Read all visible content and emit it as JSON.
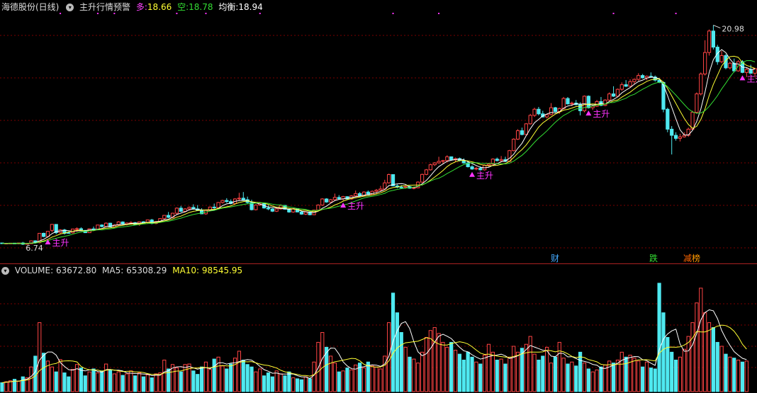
{
  "price_panel": {
    "stock_name": "海德股份(日线)",
    "indicator_name": "主升行情预警",
    "long_label": "多:",
    "long_value": "18.66",
    "short_label": "空:",
    "short_value": "18.78",
    "balance_label": "均衡:",
    "balance_value": "18.94",
    "high_marker": "20.98",
    "low_marker": "6.74",
    "signal_label": "主升"
  },
  "volume_panel": {
    "volume_label": "VOLUME:",
    "volume_value": "63672.80",
    "ma5_label": "MA5:",
    "ma5_value": "65308.29",
    "ma10_label": "MA10:",
    "ma10_value": "98545.95"
  },
  "event_tags": [
    {
      "text": "财",
      "color": "#44aaff"
    },
    {
      "text": "跌",
      "color": "#33dd33"
    },
    {
      "text": "减",
      "color": "#ff6600"
    },
    {
      "text": "榜",
      "color": "#ff9900"
    }
  ],
  "colors": {
    "up": "#ff4444",
    "down": "#4fe9f0",
    "ma_white": "#ffffff",
    "ma_yellow": "#ffff33",
    "ma_green": "#33dd33",
    "signal": "#ff33ff",
    "grid": "#7a0000"
  },
  "chart_data": {
    "type": "candlestick",
    "y_range": [
      6.0,
      21.7
    ],
    "volume_range": [
      0,
      230000
    ],
    "candles": [
      [
        6.78,
        6.78,
        6.74,
        6.74
      ],
      [
        6.75,
        6.78,
        6.73,
        6.76
      ],
      [
        6.76,
        6.77,
        6.76,
        6.77
      ],
      [
        6.77,
        6.77,
        6.72,
        6.73
      ],
      [
        6.73,
        6.8,
        6.7,
        6.78
      ],
      [
        6.78,
        6.85,
        6.65,
        6.7
      ],
      [
        6.7,
        6.76,
        6.7,
        6.74
      ],
      [
        6.73,
        6.95,
        6.72,
        6.92
      ],
      [
        6.92,
        6.95,
        6.74,
        6.8
      ],
      [
        6.8,
        7.42,
        6.75,
        7.41
      ],
      [
        7.41,
        7.45,
        7.15,
        7.2
      ],
      [
        7.2,
        7.55,
        7.15,
        7.54
      ],
      [
        7.6,
        8.02,
        7.48,
        7.99
      ],
      [
        7.99,
        7.82,
        7.35,
        7.45
      ],
      [
        7.45,
        7.68,
        7.4,
        7.63
      ],
      [
        7.63,
        7.7,
        7.33,
        7.4
      ],
      [
        7.45,
        7.52,
        7.38,
        7.44
      ],
      [
        7.44,
        7.7,
        7.4,
        7.69
      ],
      [
        7.69,
        7.8,
        7.5,
        7.71
      ],
      [
        7.71,
        7.8,
        7.56,
        7.6
      ],
      [
        7.6,
        7.62,
        7.43,
        7.45
      ],
      [
        7.45,
        7.73,
        7.44,
        7.7
      ],
      [
        7.7,
        7.85,
        7.6,
        7.65
      ],
      [
        7.65,
        7.96,
        7.6,
        7.95
      ],
      [
        7.95,
        8.0,
        7.8,
        7.85
      ],
      [
        7.85,
        8.12,
        7.8,
        8.07
      ],
      [
        8.07,
        8.1,
        7.8,
        7.83
      ],
      [
        7.83,
        8.0,
        7.78,
        7.95
      ],
      [
        7.95,
        8.2,
        7.9,
        8.15
      ],
      [
        8.15,
        8.19,
        7.95,
        8.0
      ],
      [
        8.0,
        8.12,
        7.92,
        8.08
      ],
      [
        8.08,
        8.2,
        8.0,
        8.1
      ],
      [
        8.1,
        8.15,
        7.96,
        7.98
      ],
      [
        7.98,
        8.18,
        7.9,
        8.16
      ],
      [
        8.16,
        8.2,
        8.05,
        8.12
      ],
      [
        8.12,
        8.3,
        8.05,
        8.28
      ],
      [
        8.28,
        8.35,
        8.0,
        8.05
      ],
      [
        8.05,
        8.2,
        8.0,
        8.18
      ],
      [
        8.18,
        8.4,
        8.1,
        8.37
      ],
      [
        8.37,
        8.6,
        8.3,
        8.58
      ],
      [
        8.58,
        8.8,
        8.4,
        8.45
      ],
      [
        8.45,
        8.75,
        8.4,
        8.72
      ],
      [
        8.72,
        9.1,
        8.65,
        9.05
      ],
      [
        9.05,
        9.2,
        8.8,
        8.84
      ],
      [
        8.84,
        9.05,
        8.78,
        9.0
      ],
      [
        9.0,
        9.16,
        8.9,
        9.1
      ],
      [
        9.1,
        9.3,
        8.95,
        9.0
      ],
      [
        9.0,
        9.25,
        8.88,
        8.91
      ],
      [
        8.91,
        9.05,
        8.65,
        8.68
      ],
      [
        8.68,
        8.95,
        8.62,
        8.9
      ],
      [
        8.9,
        9.15,
        8.85,
        9.12
      ],
      [
        9.12,
        9.35,
        9.0,
        9.07
      ],
      [
        9.07,
        9.45,
        9.05,
        9.42
      ],
      [
        9.42,
        9.6,
        9.35,
        9.55
      ],
      [
        9.55,
        9.7,
        9.4,
        9.48
      ],
      [
        9.48,
        9.62,
        9.3,
        9.35
      ],
      [
        9.35,
        9.7,
        9.3,
        9.65
      ],
      [
        9.65,
        10.05,
        9.55,
        9.7
      ],
      [
        9.7,
        10.1,
        9.55,
        9.6
      ],
      [
        9.6,
        9.8,
        9.35,
        9.42
      ],
      [
        9.42,
        9.6,
        8.9,
        8.95
      ],
      [
        8.95,
        9.3,
        8.9,
        9.25
      ],
      [
        9.25,
        9.45,
        9.2,
        9.38
      ],
      [
        9.38,
        9.4,
        9.02,
        9.06
      ],
      [
        9.06,
        9.25,
        8.92,
        9.0
      ],
      [
        9.0,
        9.05,
        8.8,
        8.85
      ],
      [
        8.85,
        9.1,
        8.8,
        9.0
      ],
      [
        9.0,
        9.3,
        8.95,
        9.23
      ],
      [
        9.23,
        9.25,
        8.95,
        8.98
      ],
      [
        8.98,
        9.0,
        8.75,
        8.8
      ],
      [
        8.8,
        9.05,
        8.75,
        9.02
      ],
      [
        9.02,
        9.05,
        8.78,
        8.8
      ],
      [
        8.8,
        8.88,
        8.62,
        8.66
      ],
      [
        8.66,
        8.82,
        8.6,
        8.8
      ],
      [
        8.8,
        8.82,
        8.58,
        8.62
      ],
      [
        8.62,
        8.95,
        8.6,
        8.92
      ],
      [
        8.92,
        9.3,
        8.9,
        9.25
      ],
      [
        9.25,
        9.7,
        9.2,
        9.65
      ],
      [
        9.65,
        9.7,
        9.4,
        9.45
      ],
      [
        9.45,
        9.65,
        9.4,
        9.6
      ],
      [
        9.6,
        10.0,
        9.55,
        9.75
      ],
      [
        9.75,
        9.9,
        9.6,
        9.66
      ],
      [
        9.66,
        9.85,
        9.55,
        9.8
      ],
      [
        9.8,
        9.82,
        9.6,
        9.65
      ],
      [
        9.65,
        9.9,
        9.6,
        9.85
      ],
      [
        9.85,
        10.2,
        9.8,
        10.0
      ],
      [
        10.0,
        10.1,
        9.8,
        9.86
      ],
      [
        9.86,
        10.15,
        9.8,
        10.1
      ],
      [
        10.1,
        10.2,
        9.9,
        9.93
      ],
      [
        9.93,
        10.2,
        9.9,
        10.15
      ],
      [
        10.15,
        10.3,
        10.0,
        10.22
      ],
      [
        10.22,
        10.5,
        10.15,
        10.3
      ],
      [
        10.3,
        10.9,
        10.25,
        10.7
      ],
      [
        10.7,
        11.3,
        10.65,
        11.24
      ],
      [
        11.24,
        11.2,
        10.48,
        10.5
      ],
      [
        10.5,
        10.6,
        10.35,
        10.42
      ],
      [
        10.42,
        10.55,
        10.3,
        10.4
      ],
      [
        10.4,
        10.5,
        10.32,
        10.45
      ],
      [
        10.45,
        10.55,
        10.32,
        10.35
      ],
      [
        10.35,
        10.45,
        10.28,
        10.38
      ],
      [
        10.38,
        10.8,
        10.35,
        10.75
      ],
      [
        10.75,
        11.3,
        10.7,
        11.25
      ],
      [
        11.25,
        11.6,
        11.2,
        11.55
      ],
      [
        11.55,
        11.95,
        11.5,
        11.88
      ],
      [
        11.88,
        12.05,
        11.8,
        12.0
      ],
      [
        12.0,
        12.4,
        11.95,
        12.1
      ],
      [
        12.1,
        12.2,
        11.95,
        12.15
      ],
      [
        12.15,
        12.5,
        12.05,
        12.4
      ],
      [
        12.4,
        12.42,
        12.15,
        12.2
      ],
      [
        12.2,
        12.35,
        12.1,
        12.28
      ],
      [
        12.28,
        12.35,
        12.1,
        12.16
      ],
      [
        12.16,
        12.3,
        11.95,
        12.0
      ],
      [
        12.0,
        12.1,
        11.7,
        11.75
      ],
      [
        11.75,
        11.85,
        11.55,
        11.6
      ],
      [
        11.6,
        11.75,
        11.52,
        11.65
      ],
      [
        11.65,
        11.78,
        11.5,
        11.55
      ],
      [
        11.55,
        11.9,
        11.5,
        11.85
      ],
      [
        11.85,
        12.0,
        11.75,
        11.92
      ],
      [
        11.92,
        12.3,
        11.85,
        12.25
      ],
      [
        12.25,
        12.35,
        12.1,
        12.15
      ],
      [
        12.15,
        12.45,
        12.05,
        12.22
      ],
      [
        12.22,
        12.4,
        12.05,
        12.1
      ],
      [
        12.1,
        12.85,
        12.05,
        12.8
      ],
      [
        12.8,
        13.6,
        12.75,
        13.55
      ],
      [
        13.55,
        14.2,
        13.5,
        14.1
      ],
      [
        14.1,
        14.3,
        13.8,
        13.85
      ],
      [
        13.85,
        14.6,
        13.8,
        14.55
      ],
      [
        14.55,
        15.2,
        14.5,
        15.1
      ],
      [
        15.1,
        15.6,
        15.0,
        15.5
      ],
      [
        15.5,
        15.65,
        15.1,
        15.2
      ],
      [
        15.2,
        15.4,
        14.95,
        15.0
      ],
      [
        15.0,
        15.2,
        14.9,
        15.15
      ],
      [
        15.15,
        15.9,
        15.1,
        15.6
      ],
      [
        15.6,
        15.65,
        15.3,
        15.35
      ],
      [
        15.35,
        15.6,
        15.2,
        15.55
      ],
      [
        15.55,
        16.3,
        15.5,
        16.2
      ],
      [
        16.2,
        16.3,
        15.8,
        15.85
      ],
      [
        15.85,
        16.0,
        15.7,
        15.9
      ],
      [
        15.9,
        16.1,
        15.75,
        15.8
      ],
      [
        15.8,
        15.95,
        15.1,
        15.4
      ],
      [
        15.4,
        16.4,
        15.3,
        16.35
      ],
      [
        16.35,
        16.4,
        15.55,
        15.6
      ],
      [
        15.6,
        15.8,
        15.45,
        15.7
      ],
      [
        15.7,
        16.1,
        15.65,
        16.0
      ],
      [
        16.0,
        16.3,
        15.7,
        15.75
      ],
      [
        15.75,
        16.15,
        15.7,
        16.1
      ],
      [
        16.1,
        16.6,
        16.0,
        16.5
      ],
      [
        16.5,
        17.0,
        16.3,
        16.35
      ],
      [
        16.35,
        16.85,
        16.3,
        16.8
      ],
      [
        16.8,
        17.25,
        16.7,
        17.1
      ],
      [
        17.1,
        17.4,
        16.95,
        17.0
      ],
      [
        17.0,
        17.45,
        16.95,
        17.3
      ],
      [
        17.3,
        17.5,
        17.1,
        17.45
      ],
      [
        17.45,
        17.85,
        17.35,
        17.7
      ],
      [
        17.7,
        17.8,
        17.5,
        17.55
      ],
      [
        17.55,
        17.7,
        17.4,
        17.65
      ],
      [
        17.65,
        17.9,
        17.55,
        17.6
      ],
      [
        17.6,
        17.7,
        17.3,
        17.4
      ],
      [
        17.4,
        17.55,
        17.2,
        17.25
      ],
      [
        17.25,
        17.3,
        15.3,
        15.5
      ],
      [
        15.5,
        15.6,
        14.0,
        14.2
      ],
      [
        14.2,
        14.4,
        12.55,
        13.8
      ],
      [
        13.8,
        14.0,
        13.45,
        13.6
      ],
      [
        13.6,
        13.9,
        13.4,
        13.7
      ],
      [
        13.7,
        14.0,
        13.65,
        13.8
      ],
      [
        13.8,
        14.3,
        13.7,
        14.2
      ],
      [
        14.2,
        15.4,
        14.1,
        15.3
      ],
      [
        15.3,
        16.6,
        15.2,
        16.5
      ],
      [
        16.5,
        17.9,
        16.4,
        17.8
      ],
      [
        17.8,
        20.0,
        17.7,
        19.2
      ],
      [
        19.2,
        20.7,
        19.0,
        20.6
      ],
      [
        20.6,
        20.98,
        19.4,
        19.55
      ],
      [
        19.55,
        19.7,
        18.4,
        18.6
      ],
      [
        18.6,
        19.3,
        18.5,
        19.0
      ],
      [
        19.0,
        19.1,
        18.1,
        18.2
      ],
      [
        18.2,
        18.6,
        18.1,
        18.5
      ],
      [
        18.5,
        18.8,
        17.9,
        18.0
      ],
      [
        18.0,
        18.7,
        17.95,
        18.6
      ],
      [
        18.6,
        18.7,
        17.85,
        17.9
      ],
      [
        17.9,
        18.2,
        17.6,
        18.1
      ],
      [
        18.1,
        18.4,
        17.8,
        17.85
      ],
      [
        17.85,
        18.2,
        17.6,
        18.15
      ]
    ],
    "volumes": [
      18000,
      20000,
      22000,
      25000,
      21000,
      30000,
      28000,
      50000,
      72000,
      140000,
      78000,
      62000,
      50000,
      40000,
      65000,
      38000,
      30000,
      45000,
      55000,
      48000,
      32000,
      40000,
      46000,
      38000,
      42000,
      56000,
      44000,
      36000,
      40000,
      33000,
      36000,
      42000,
      32000,
      38000,
      30000,
      34000,
      28000,
      36000,
      38000,
      64000,
      46000,
      55000,
      48000,
      40000,
      55000,
      56000,
      42000,
      35000,
      50000,
      60000,
      45000,
      66000,
      70000,
      52000,
      46000,
      56000,
      68000,
      82000,
      64000,
      55000,
      50000,
      40000,
      46000,
      32000,
      38000,
      30000,
      42000,
      36000,
      32000,
      40000,
      28000,
      26000,
      24000,
      30000,
      26000,
      60000,
      100000,
      120000,
      90000,
      72000,
      58000,
      40000,
      42000,
      48000,
      44000,
      54000,
      58000,
      48000,
      60000,
      52000,
      50000,
      46000,
      72000,
      140000,
      200000,
      160000,
      120000,
      90000,
      70000,
      66000,
      58000,
      80000,
      110000,
      124000,
      130000,
      118000,
      100000,
      90000,
      100000,
      84000,
      76000,
      64000,
      80000,
      70000,
      60000,
      56000,
      74000,
      96000,
      80000,
      64000,
      66000,
      56000,
      70000,
      92000,
      80000,
      88000,
      96000,
      112000,
      76000,
      64000,
      72000,
      90000,
      58000,
      70000,
      100000,
      68000,
      56000,
      60000,
      52000,
      80000,
      58000,
      46000,
      40000,
      44000,
      50000,
      54000,
      62000,
      58000,
      64000,
      80000,
      70000,
      74000,
      68000,
      62000,
      50000,
      60000,
      48000,
      46000,
      220000,
      160000,
      110000,
      80000,
      64000,
      70000,
      86000,
      112000,
      140000,
      180000,
      210000,
      160000,
      140000,
      130000,
      100000,
      92000,
      76000,
      70000,
      68000,
      64000,
      60000,
      62000
    ]
  }
}
